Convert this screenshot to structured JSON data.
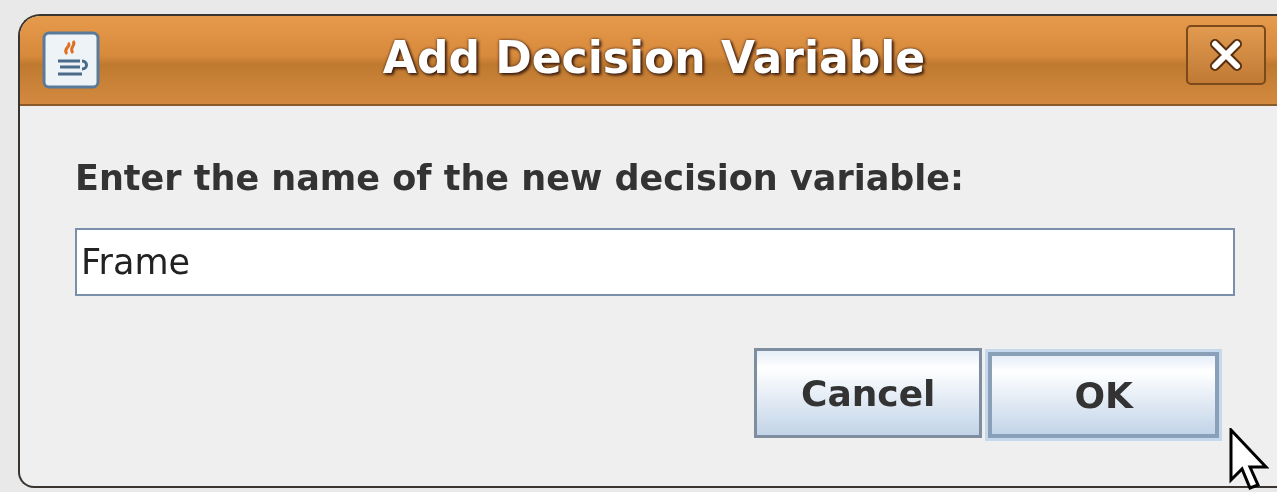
{
  "window": {
    "title": "Add Decision Variable"
  },
  "prompt": "Enter the name of the new decision variable:",
  "name_field": {
    "value": "Frame",
    "focused": true
  },
  "buttons": [
    {
      "label": "Cancel",
      "default": false
    },
    {
      "label": "OK",
      "default": true
    }
  ]
}
